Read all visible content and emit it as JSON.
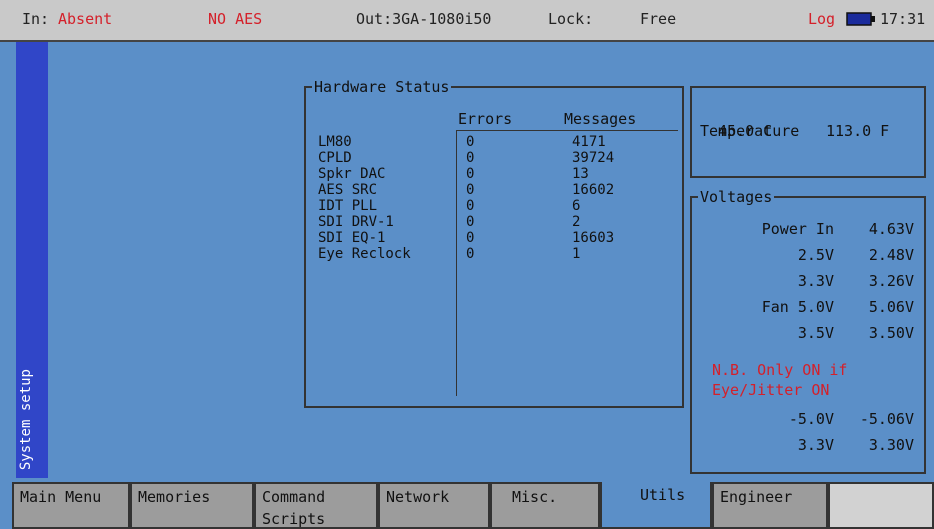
{
  "status_bar": {
    "in_label": "In:",
    "in_value": "Absent",
    "aes": "NO AES",
    "out": "Out:3GA-1080i50",
    "lock_label": "Lock:",
    "lock_value": "Free",
    "log": "Log",
    "time": "17:31",
    "colors": {
      "alert": "#d4202a",
      "bar": "#c9c9c9"
    }
  },
  "sidebar": {
    "label": "System setup"
  },
  "hardware_status": {
    "title": "Hardware Status",
    "columns": [
      "Errors",
      "Messages"
    ],
    "rows": [
      {
        "name": "LM80",
        "errors": "0",
        "messages": "4171"
      },
      {
        "name": "CPLD",
        "errors": "0",
        "messages": "39724"
      },
      {
        "name": "Spkr DAC",
        "errors": "0",
        "messages": "13"
      },
      {
        "name": "AES SRC",
        "errors": "0",
        "messages": "16602"
      },
      {
        "name": "IDT PLL",
        "errors": "0",
        "messages": "6"
      },
      {
        "name": "SDI DRV-1",
        "errors": "0",
        "messages": "2"
      },
      {
        "name": "SDI EQ-1",
        "errors": "0",
        "messages": "16603"
      },
      {
        "name": "Eye Reclock",
        "errors": "0",
        "messages": "1"
      }
    ]
  },
  "temperature": {
    "title": "Temperature",
    "celsius": "45.0 C",
    "fahrenheit": "113.0 F"
  },
  "voltages": {
    "title": "Voltages",
    "rows": [
      {
        "label": "Power In",
        "value": "4.63V"
      },
      {
        "label": "2.5V",
        "value": "2.48V"
      },
      {
        "label": "3.3V",
        "value": "3.26V"
      },
      {
        "label": "Fan 5.0V",
        "value": "5.06V"
      },
      {
        "label": "3.5V",
        "value": "3.50V"
      }
    ],
    "note": "N.B. Only ON if\nEye/Jitter ON",
    "rows_after": [
      {
        "label": "-5.0V",
        "value": "-5.06V"
      },
      {
        "label": "3.3V",
        "value": "3.30V"
      }
    ]
  },
  "tabs": [
    {
      "label": "Main Menu"
    },
    {
      "label": "Memories"
    },
    {
      "label": "Command Scripts"
    },
    {
      "label": "Network"
    },
    {
      "label": "Misc."
    },
    {
      "label": "Utils",
      "active": true
    },
    {
      "label": "Engineer"
    },
    {
      "label": ""
    }
  ],
  "battery_icon": "battery-icon",
  "background_color": "#5b8fc8"
}
